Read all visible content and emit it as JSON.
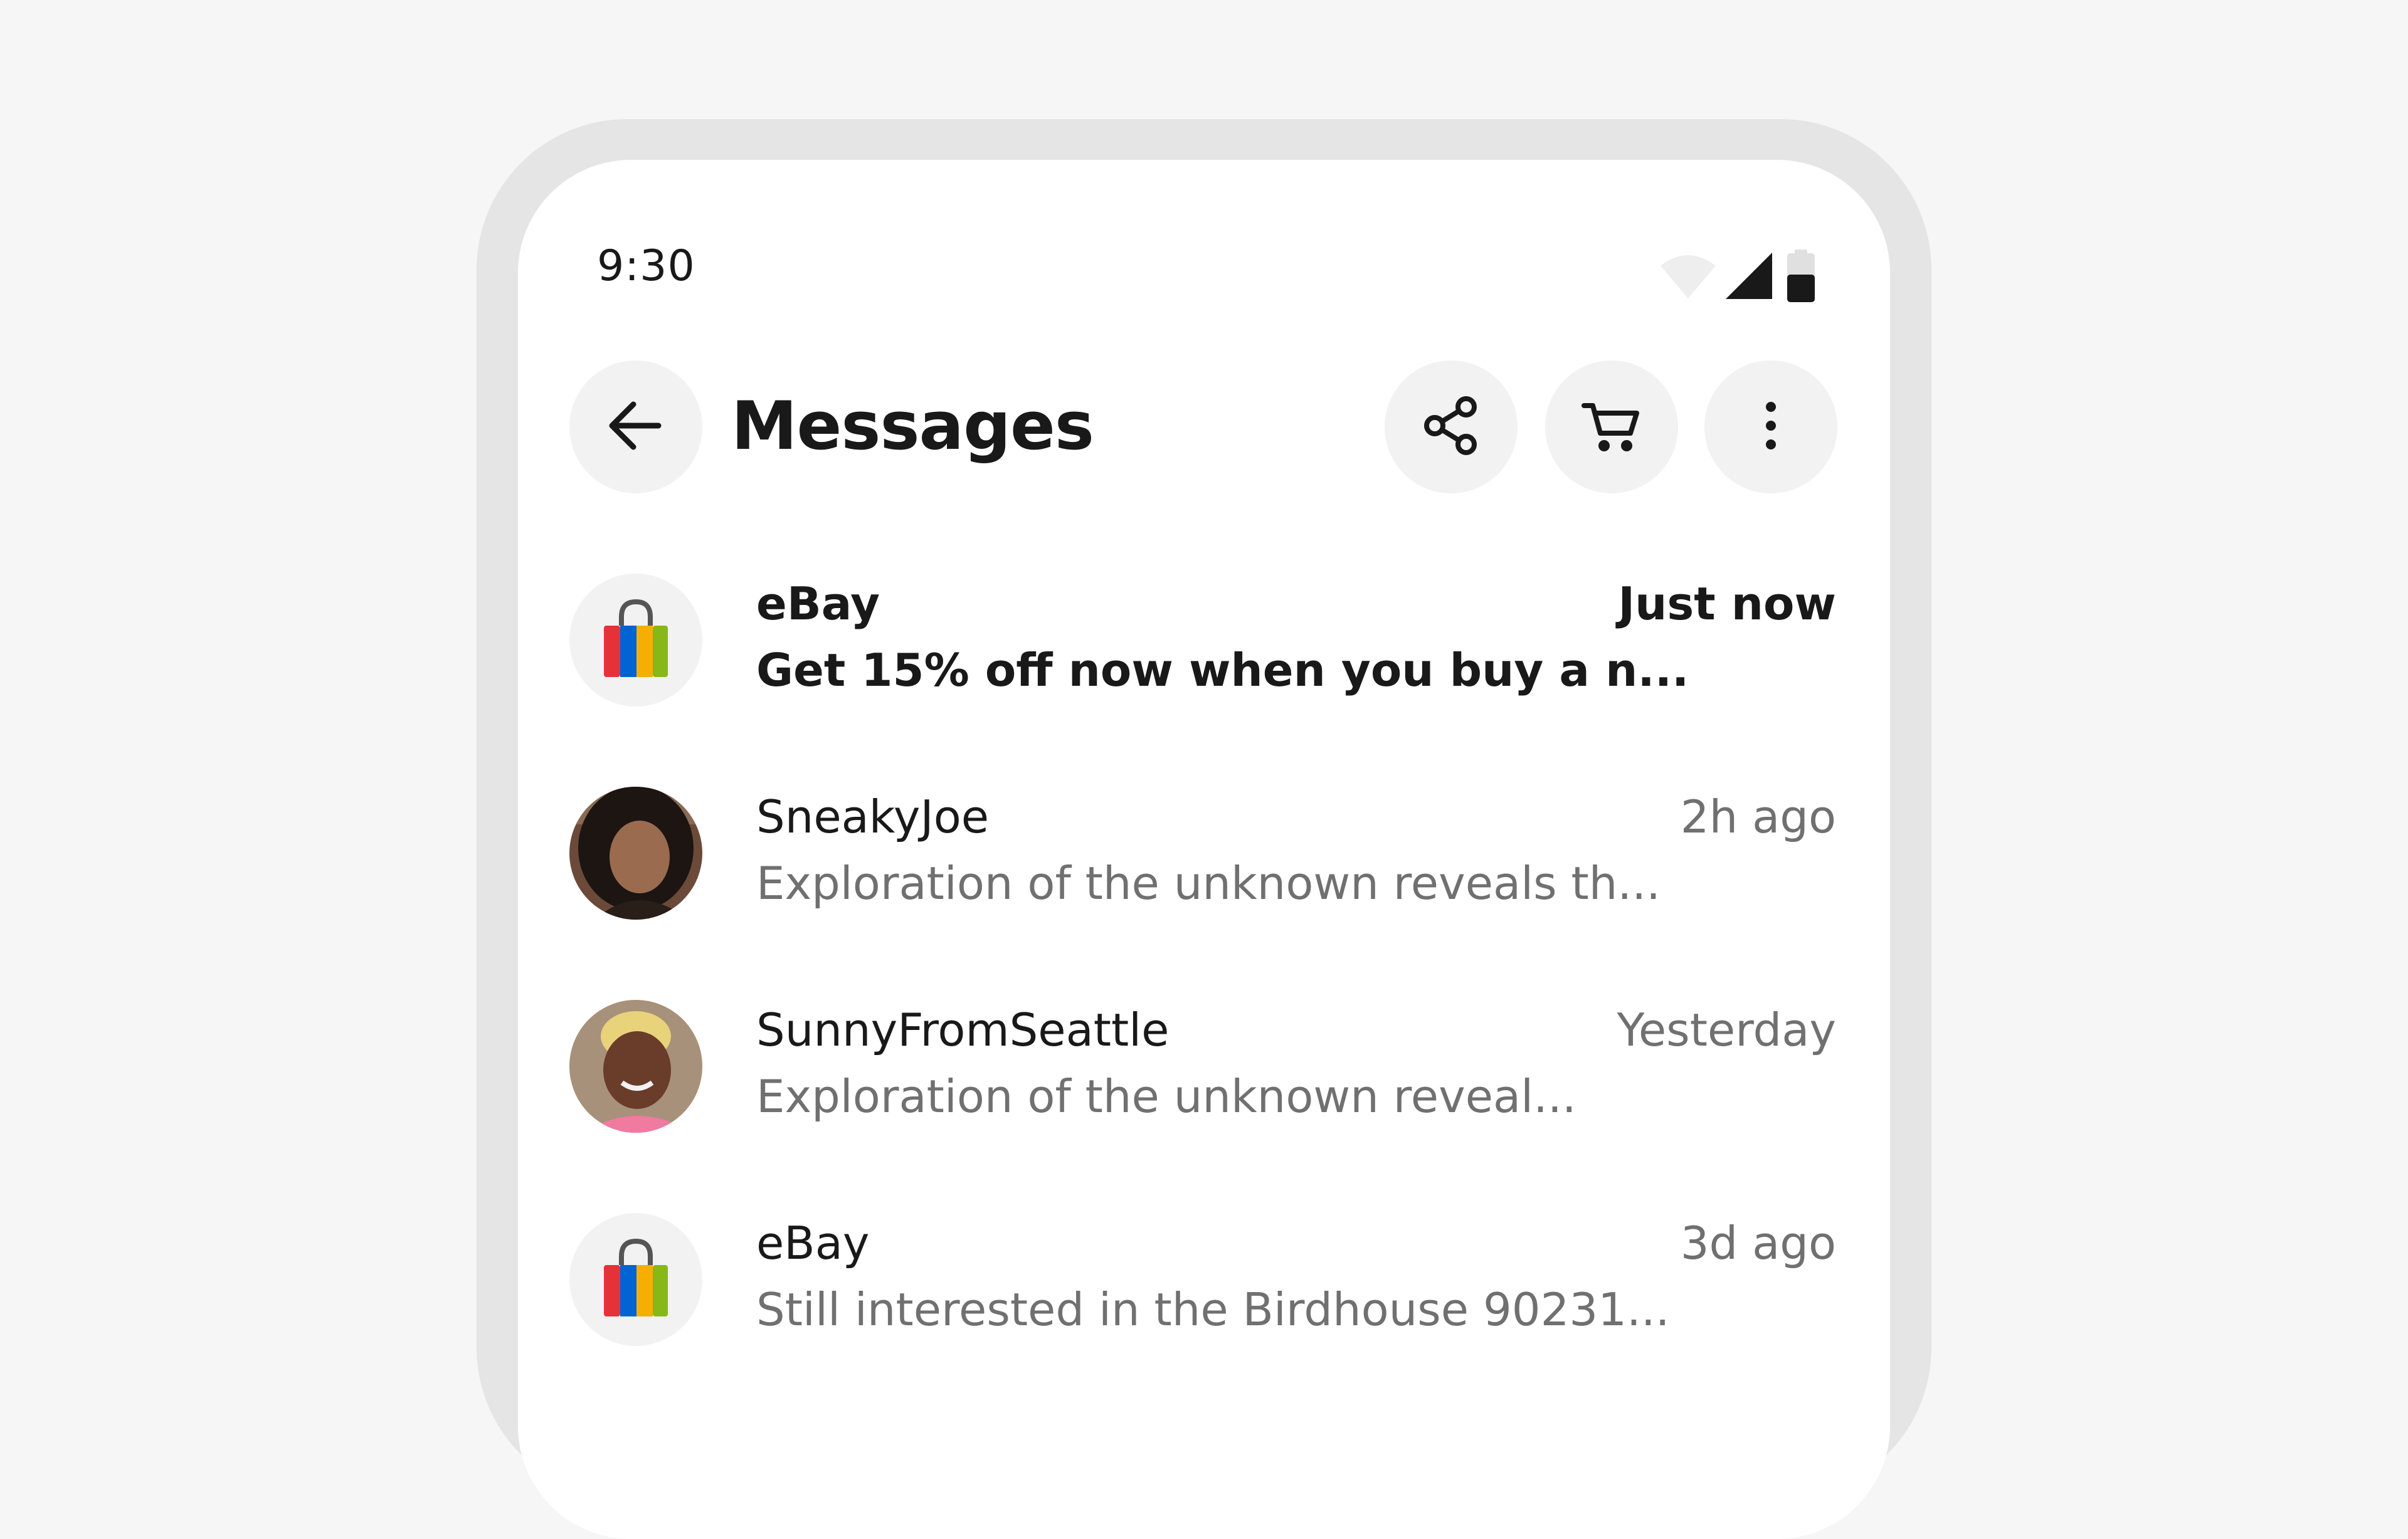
{
  "status_bar": {
    "time": "9:30",
    "icons": [
      "wifi-icon",
      "signal-icon",
      "battery-icon"
    ]
  },
  "app_bar": {
    "title": "Messages",
    "back_icon": "arrow-left-icon",
    "share_icon": "share-icon",
    "cart_icon": "cart-icon",
    "more_icon": "more-vertical-icon"
  },
  "messages": [
    {
      "sender": "eBay",
      "preview": "Get 15% off now when you buy a n...",
      "time": "Just now",
      "unread": true,
      "avatar": "ebay-bag-icon"
    },
    {
      "sender": "SneakyJoe",
      "preview": "Exploration of the unknown reveals th...",
      "time": "2h ago",
      "unread": false,
      "avatar": "user-photo"
    },
    {
      "sender": "SunnyFromSeattle",
      "preview": "Exploration of the unknown reveal...",
      "time": "Yesterday",
      "unread": false,
      "avatar": "user-photo"
    },
    {
      "sender": "eBay",
      "preview": "Still interested in the Birdhouse 90231...",
      "time": "3d ago",
      "unread": false,
      "avatar": "ebay-bag-icon"
    }
  ],
  "colors": {
    "background": "#f6f6f6",
    "frame": "#e5e5e5",
    "screen": "#ffffff",
    "button_bg": "#f2f2f2",
    "primary_text": "#191919",
    "secondary_text": "#707070",
    "brand_red": "#e53238",
    "brand_blue": "#0064d2",
    "brand_yellow": "#f5af02",
    "brand_green": "#86b817"
  }
}
